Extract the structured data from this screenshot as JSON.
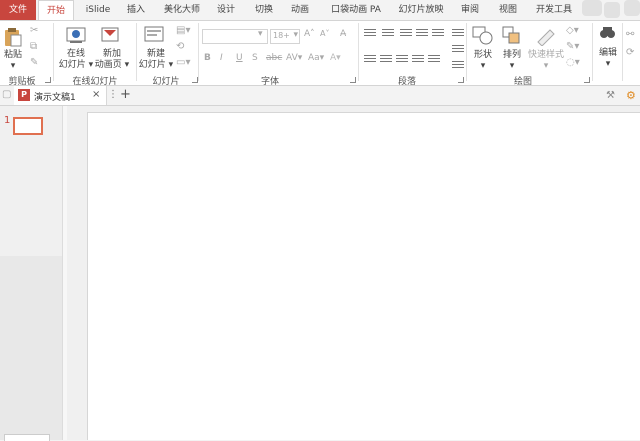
{
  "tabs": [
    {
      "label": "文件"
    },
    {
      "label": "开始"
    },
    {
      "label": "iSlide"
    },
    {
      "label": "插入"
    },
    {
      "label": "美化大师"
    },
    {
      "label": "设计"
    },
    {
      "label": "切换"
    },
    {
      "label": "动画"
    },
    {
      "label": "口袋动画 PA"
    },
    {
      "label": "幻灯片放映"
    },
    {
      "label": "审阅"
    },
    {
      "label": "视图"
    },
    {
      "label": "开发工具"
    }
  ],
  "ribbon": {
    "clipboard": {
      "paste": "粘贴",
      "label": "剪贴板"
    },
    "online": {
      "online_slide_1": "在线",
      "online_slide_2": "幻灯片",
      "new_anim_1": "新加",
      "new_anim_2": "动画页",
      "label": "在线幻灯片"
    },
    "slides": {
      "new_slide_1": "新建",
      "new_slide_2": "幻灯片",
      "label": "幻灯片"
    },
    "font": {
      "size": "18+",
      "label": "字体"
    },
    "paragraph": {
      "label": "段落"
    },
    "drawing": {
      "shape": "形状",
      "arrange": "排列",
      "quick_style": "快速样式",
      "label": "绘图"
    },
    "editing": {
      "edit": "编辑"
    }
  },
  "doc": {
    "tab_title": "演示文稿1",
    "close": "×",
    "more": "⋮",
    "add": "+"
  },
  "thumbnails": [
    {
      "number": "1"
    }
  ],
  "colors": {
    "accent": "#c8463e",
    "file_tab": "#c8463e"
  }
}
